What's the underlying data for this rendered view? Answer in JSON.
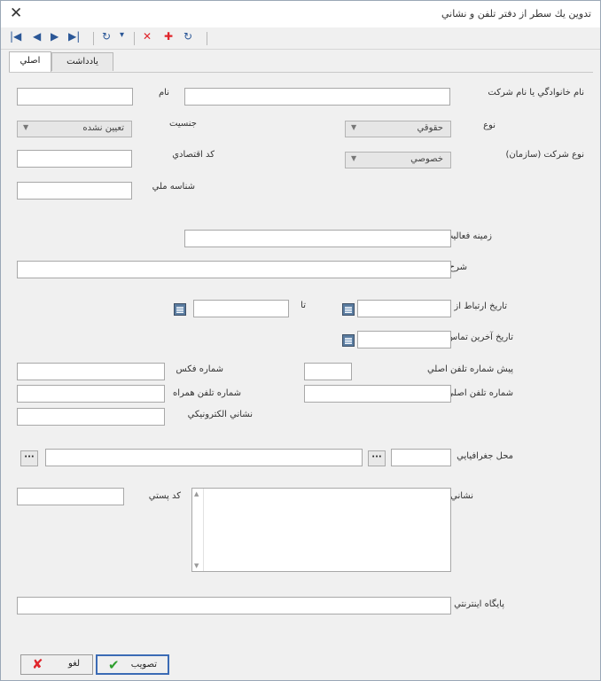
{
  "window": {
    "title": "تدوين يك سطر از دفتر تلفن و نشاني"
  },
  "toolbar": {
    "first": "|◀",
    "prev": "◀",
    "next": "▶",
    "last": "▶|",
    "refresh_drop": "▾",
    "delete": "✕",
    "add": "✚",
    "reload": "↻"
  },
  "tabs": [
    {
      "label": "اصلي"
    },
    {
      "label": "يادداشت"
    }
  ],
  "form": {
    "family_label": "نام خانوادگي يا نام شركت",
    "name_label": "نام",
    "type_label": "نوع",
    "type_value": "حقوقي",
    "gender_label": "جنسيت",
    "gender_value": "تعيين نشده",
    "org_type_label": "نوع  شركت (سازمان)",
    "org_type_value": "خصوصي",
    "economic_code_label": "كد اقتصادي",
    "national_id_label": "شناسه ملي",
    "activity_label": "زمينه فعاليت",
    "description_label": "شرح",
    "contact_date_from_label": "تاريخ ارتباط از",
    "contact_date_to_label": "تا",
    "last_contact_label": "تاريخ آخرين تماس",
    "phone_prefix_label": "پيش شماره تلفن اصلي",
    "fax_label": "شماره فكس",
    "main_phone_label": "شماره تلفن اصلي",
    "mobile_label": "شماره تلفن همراه",
    "email_label": "نشاني الكترونيكي",
    "geo_label": "محل جغرافيايي",
    "address_label": "نشاني",
    "postal_code_label": "كد پستي",
    "website_label": "پايگاه اينترنتي"
  },
  "buttons": {
    "ok": "تصويب",
    "cancel": "لغو"
  },
  "colors": {
    "accent": "#2b5797",
    "danger": "#e0262c",
    "ok_green": "#2e9e2e"
  }
}
